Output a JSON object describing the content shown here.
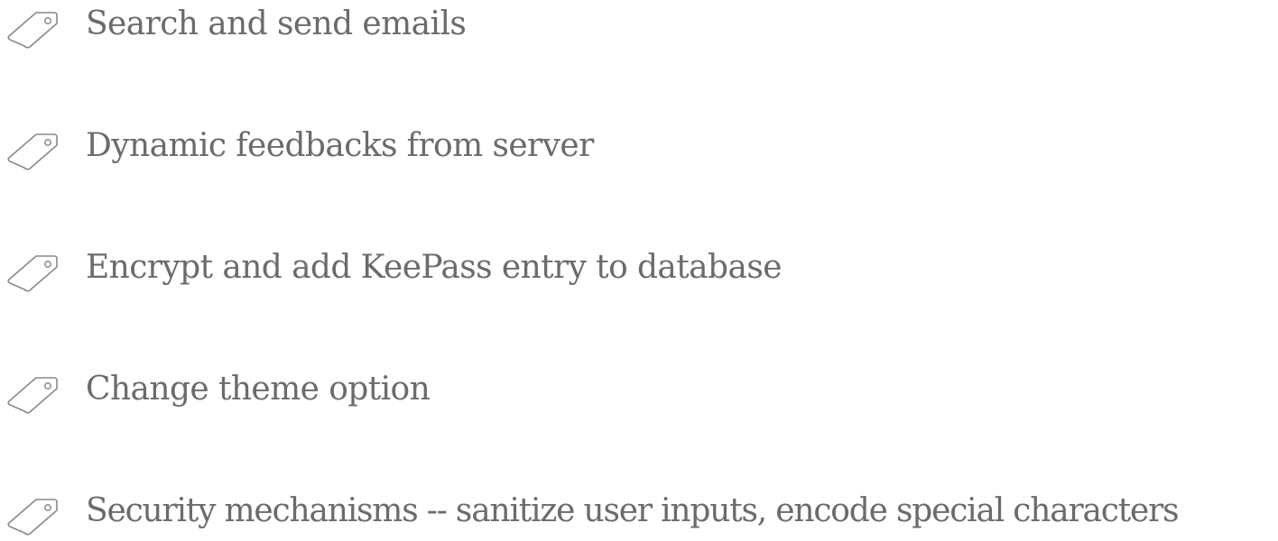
{
  "features": {
    "items": [
      {
        "label": "Search and send emails",
        "icon": "tag-icon"
      },
      {
        "label": "Dynamic feedbacks from server",
        "icon": "tag-icon"
      },
      {
        "label": "Encrypt and add KeePass entry to database",
        "icon": "tag-icon"
      },
      {
        "label": "Change theme option",
        "icon": "tag-icon"
      },
      {
        "label": "Security mechanisms -- sanitize user inputs, encode special characters",
        "icon": "tag-icon"
      }
    ]
  },
  "colors": {
    "text": "#6b6b6b",
    "icon_stroke": "#8a8a8a",
    "background": "#ffffff"
  }
}
